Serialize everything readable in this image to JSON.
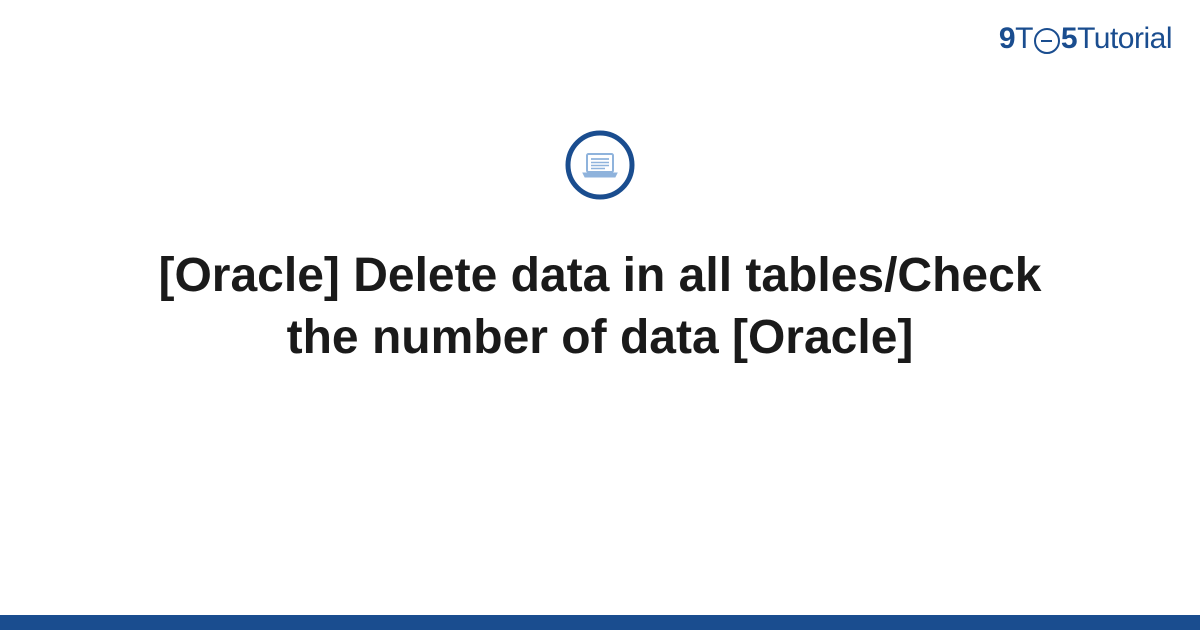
{
  "brand": {
    "nine": "9",
    "t": "T",
    "five": "5",
    "tutorial": "Tutorial"
  },
  "title": "[Oracle] Delete data in all tables/Check the number of data [Oracle]",
  "colors": {
    "primary": "#1a4d8f",
    "accent_light": "#b8cce8",
    "text": "#1a1a1a"
  }
}
